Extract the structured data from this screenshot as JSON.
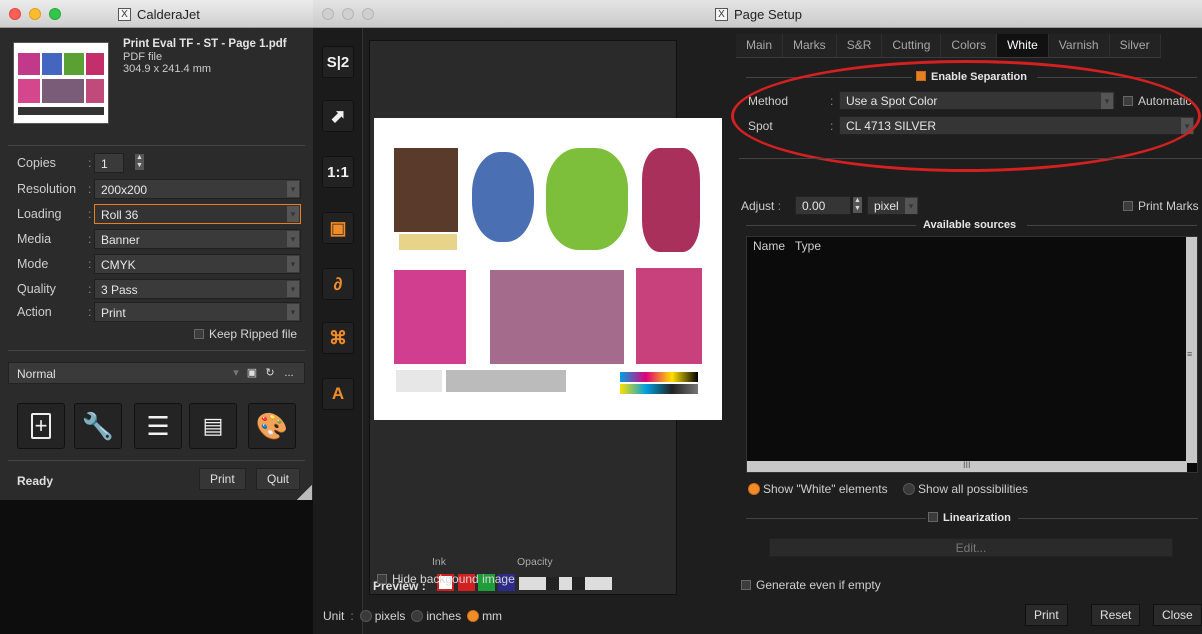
{
  "left_window": {
    "title": "CalderaJet",
    "file": {
      "name": "Print Eval TF - ST - Page 1.pdf",
      "type": "PDF file",
      "size": "304.9 x 241.4 mm"
    },
    "fields": {
      "copies": {
        "label": "Copies",
        "value": "1"
      },
      "resolution": {
        "label": "Resolution",
        "value": "200x200"
      },
      "loading": {
        "label": "Loading",
        "value": "Roll 36"
      },
      "media": {
        "label": "Media",
        "value": "Banner"
      },
      "mode": {
        "label": "Mode",
        "value": "CMYK"
      },
      "quality": {
        "label": "Quality",
        "value": "3 Pass"
      },
      "action": {
        "label": "Action",
        "value": "Print"
      }
    },
    "keep_ripped": "Keep Ripped file",
    "preset": {
      "value": "Normal",
      "more": "..."
    },
    "big_buttons": [
      "add-file-icon",
      "wrench-icon",
      "list-icon",
      "swatch-fan-icon",
      "palette-icon"
    ],
    "status": "Ready",
    "print_label": "Print",
    "quit_label": "Quit"
  },
  "right_window": {
    "title": "Page Setup",
    "tools": [
      "S|2",
      "1:1",
      "A"
    ],
    "tabs": [
      "Main",
      "Marks",
      "S&R",
      "Cutting",
      "Colors",
      "White",
      "Varnish",
      "Silver"
    ],
    "selected_tab": "White",
    "enable_separation": "Enable Separation",
    "method": {
      "label": "Method",
      "value": "Use a Spot Color"
    },
    "automatic": "Automatic",
    "spot": {
      "label": "Spot",
      "value": "CL 4713 SILVER"
    },
    "adjust": {
      "label": "Adjust",
      "value": "0.00",
      "unit": "pixel"
    },
    "print_marks": "Print Marks",
    "available_sources": "Available sources",
    "columns": [
      "Name",
      "Type"
    ],
    "scroll_mark": "III",
    "show_white": "Show \"White\" elements",
    "show_all": "Show all possibilities",
    "linearization": "Linearization",
    "edit_label": "Edit...",
    "generate_empty": "Generate even if empty",
    "preview": {
      "label": "Preview",
      "ink_label": "Ink",
      "opacity_label": "Opacity"
    },
    "hide_bg": "Hide backgound image",
    "unit": {
      "label": "Unit",
      "options": [
        "pixels",
        "inches",
        "mm"
      ],
      "selected": "mm"
    },
    "buttons": {
      "print": "Print",
      "reset": "Reset",
      "close": "Close"
    }
  },
  "colors": {
    "accent": "#f28c28",
    "highlight_ellipse": "#d42020"
  }
}
